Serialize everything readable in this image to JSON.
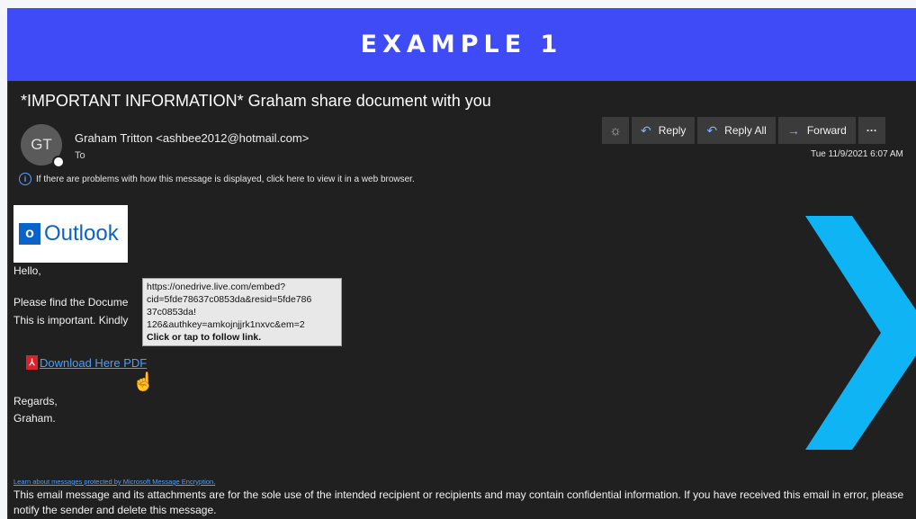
{
  "banner": {
    "title": "EXAMPLE 1"
  },
  "email": {
    "subject": "*IMPORTANT INFORMATION* Graham share document with you",
    "avatar_initials": "GT",
    "sender": "Graham Tritton <ashbee2012@hotmail.com>",
    "to_label": "To",
    "info_text": "If there are problems with how this message is displayed, click here to view it in a web browser.",
    "timestamp": "Tue 11/9/2021 6:07 AM"
  },
  "toolbar": {
    "reply": "Reply",
    "reply_all": "Reply All",
    "forward": "Forward",
    "more": "···"
  },
  "body": {
    "logo_text": "Outlook",
    "logo_tile": "o",
    "greeting": "Hello,",
    "paragraph1": "Please find the Docume",
    "paragraph2": "This is important. Kindly",
    "download_link": "Download Here PDF",
    "regards": "Regards,",
    "signoff": "Graham."
  },
  "tooltip": {
    "url_lines": [
      "https://onedrive.live.com/embed?",
      "cid=5fde78637c0853da&resid=5fde786",
      "37c0853da!",
      "126&authkey=amkojnjjrk1nxvc&em=2"
    ],
    "action": "Click or tap to follow link."
  },
  "footer": {
    "learn_link": "Learn about messages protected by Microsoft Message Encryption.",
    "disclaimer": "This email message and its attachments are for the sole use of the intended recipient or recipients and may contain confidential information. If you have received this email in error, please notify the sender and delete this message."
  },
  "colors": {
    "banner": "#3e4bf6",
    "email_bg": "#202020",
    "link": "#4aa0ff",
    "chevron": "#0fb4f5"
  }
}
